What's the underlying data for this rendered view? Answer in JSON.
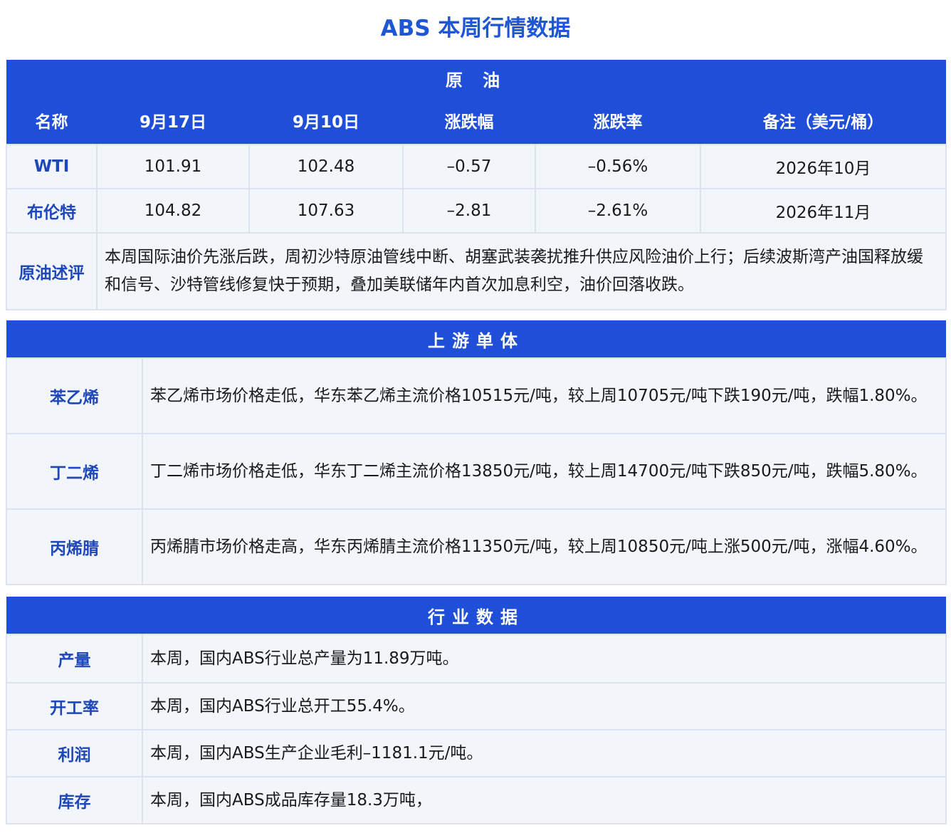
{
  "title": "ABS 本周行情数据",
  "crude": {
    "section_title": "原  油",
    "headers": [
      "名称",
      "9月17日",
      "9月10日",
      "涨跌幅",
      "涨跌率",
      "备注（美元/桶）"
    ],
    "rows": [
      {
        "name": "WTI",
        "current": "101.91",
        "previous": "102.48",
        "change": "–0.57",
        "change_rate": "–0.56%",
        "note": "2026年10月"
      },
      {
        "name": "布伦特",
        "current": "104.82",
        "previous": "107.63",
        "change": "–2.81",
        "change_rate": "–2.61%",
        "note": "2026年11月"
      }
    ],
    "comment_label": "原油述评",
    "comment": "本周国际油价先涨后跌，周初沙特原油管线中断、胡塞武装袭扰推升供应风险油价上行；后续波斯湾产油国释放缓和信号、沙特管线修复快于预期，叠加美联储年内首次加息利空，油价回落收跌。"
  },
  "upstream": {
    "section_title": "上游单体",
    "rows": [
      {
        "label": "苯乙烯",
        "text": "苯乙烯市场价格走低，华东苯乙烯主流价格10515元/吨，较上周10705元/吨下跌190元/吨，跌幅1.80%。"
      },
      {
        "label": "丁二烯",
        "text": "丁二烯市场价格走低，华东丁二烯主流价格13850元/吨，较上周14700元/吨下跌850元/吨，跌幅5.80%。"
      },
      {
        "label": "丙烯腈",
        "text": "丙烯腈市场价格走高，华东丙烯腈主流价格11350元/吨，较上周10850元/吨上涨500元/吨，涨幅4.60%。"
      }
    ]
  },
  "industry": {
    "section_title": "行业数据",
    "rows": [
      {
        "label": "产量",
        "text": "本周，国内ABS行业总产量为11.89万吨。"
      },
      {
        "label": "开工率",
        "text": "本周，国内ABS行业总开工55.4%。"
      },
      {
        "label": "利润",
        "text": "本周，国内ABS生产企业毛利–1181.1元/吨。"
      },
      {
        "label": "库存",
        "text": "本周，国内ABS成品库存量18.3万吨，"
      }
    ]
  }
}
